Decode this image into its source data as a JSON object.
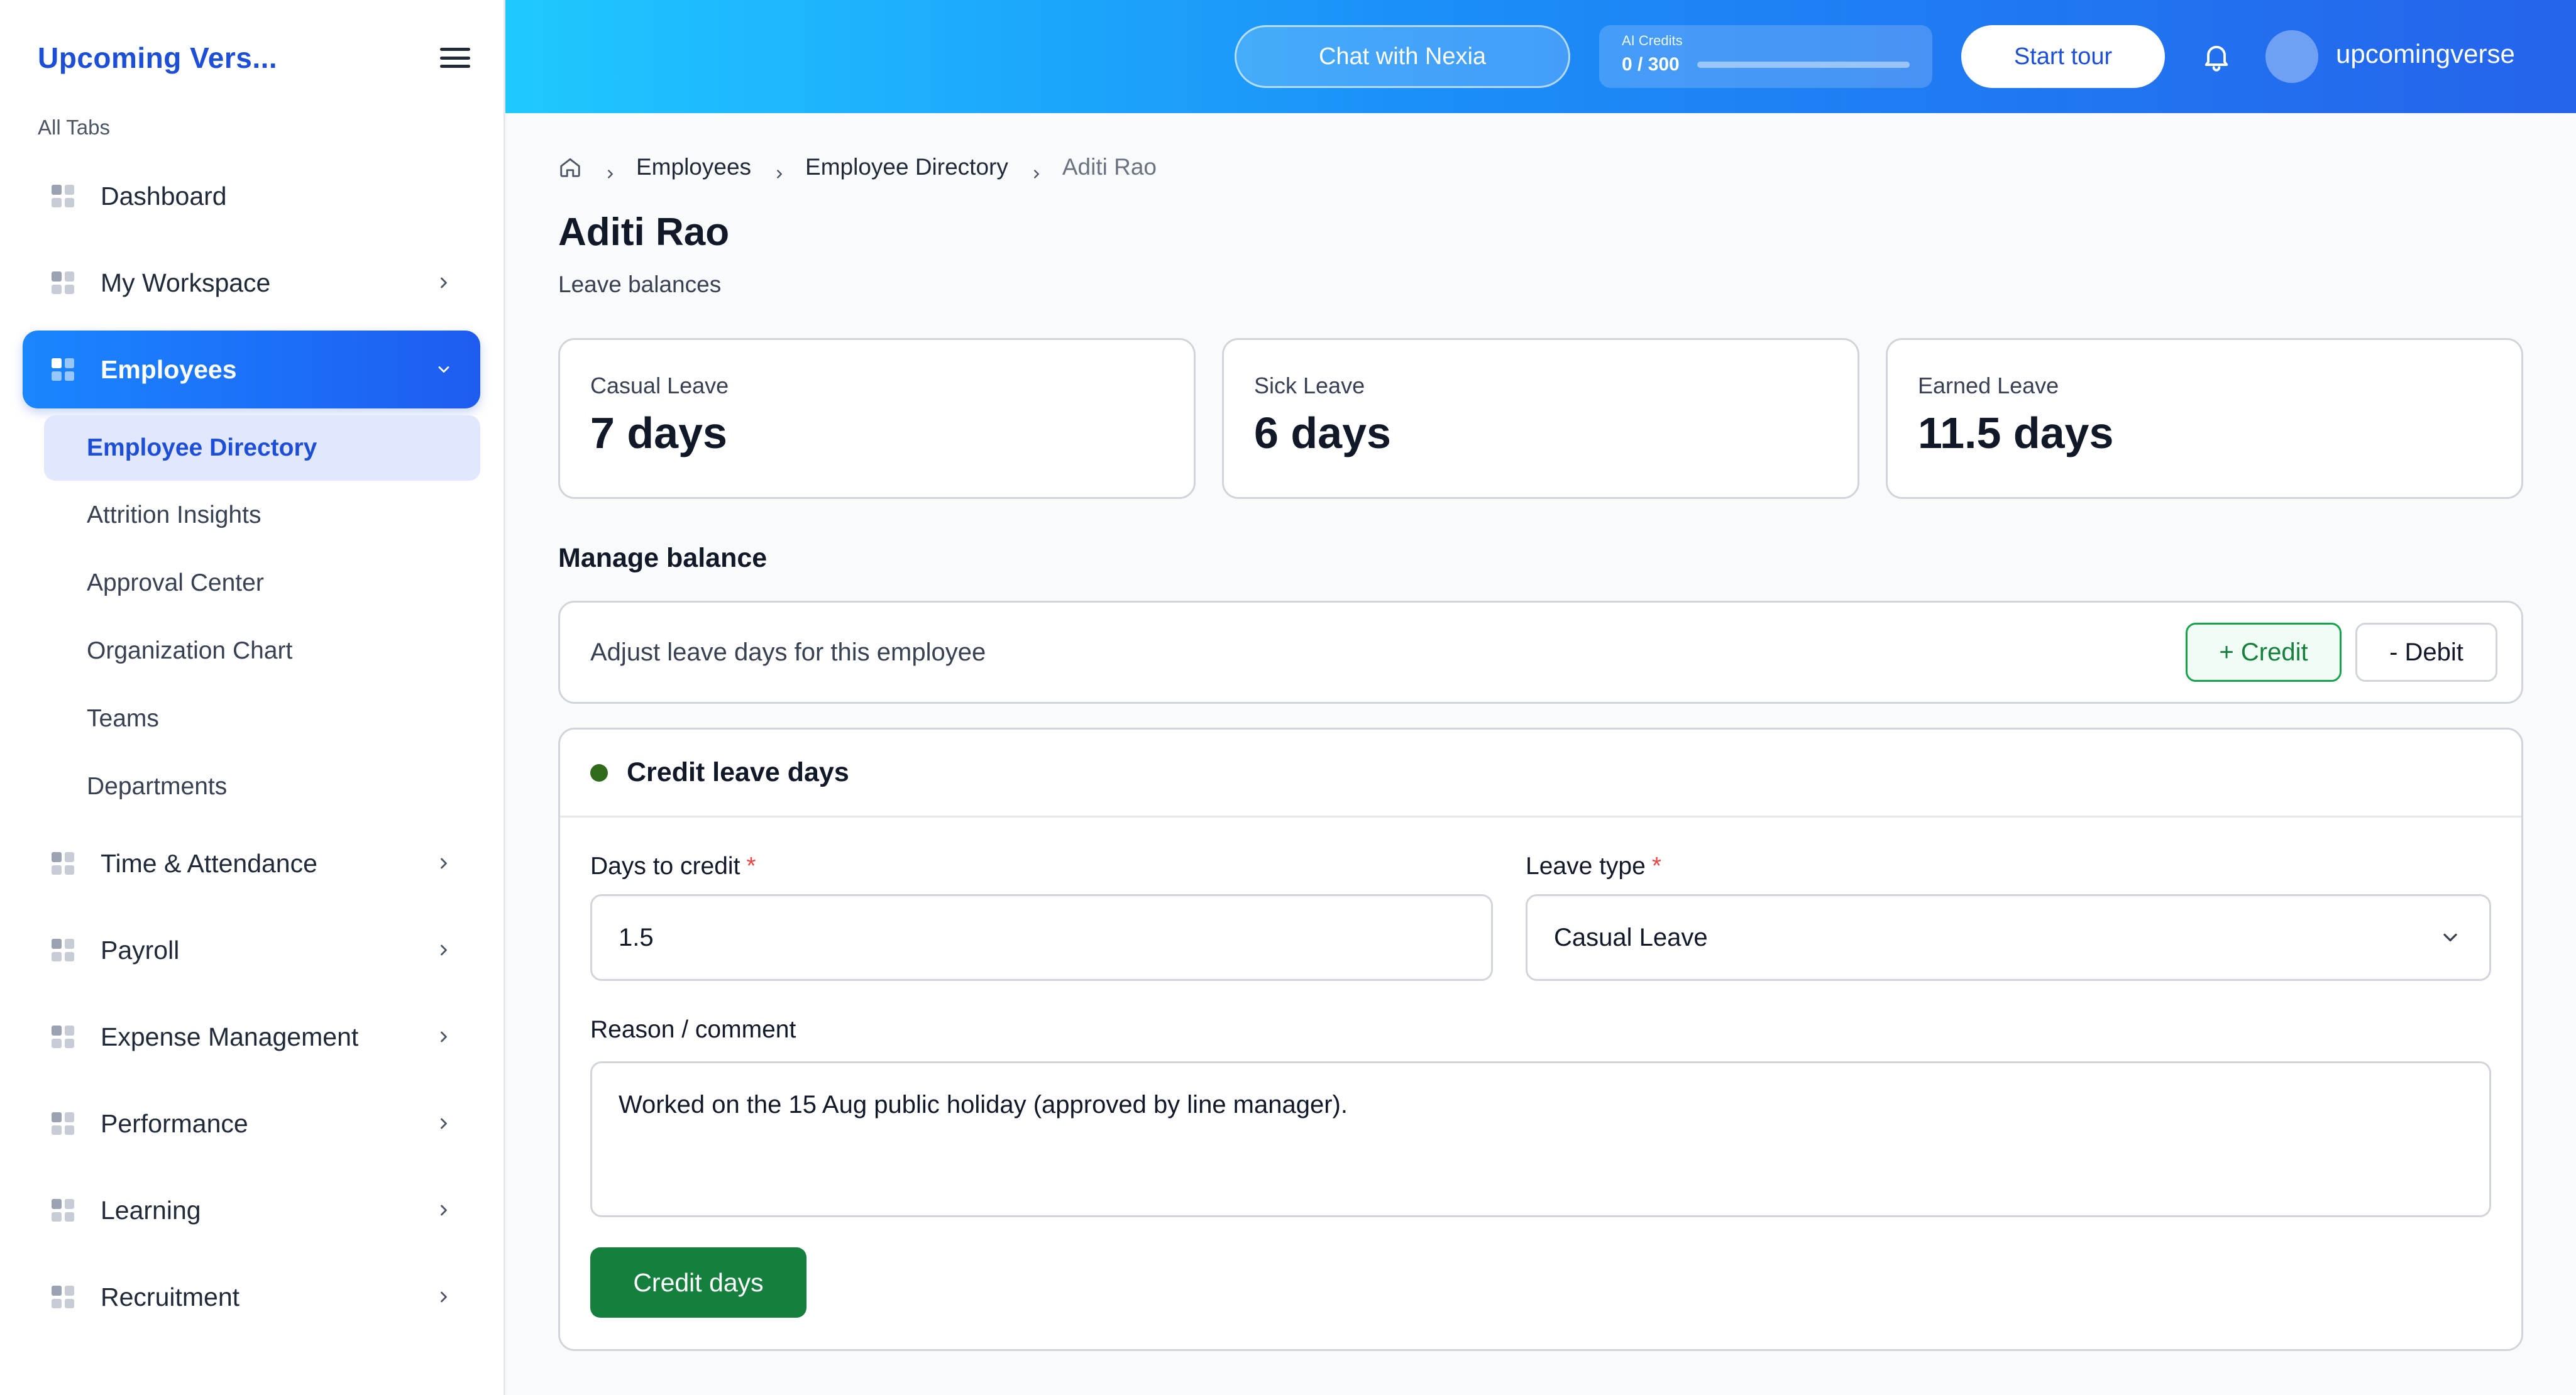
{
  "app": {
    "brand": "Upcoming Vers...",
    "all_tabs_label": "All Tabs"
  },
  "sidebar": {
    "items": [
      {
        "label": "Dashboard",
        "icon": "grid-icon",
        "has_chevron": false
      },
      {
        "label": "My Workspace",
        "icon": "grid-icon",
        "has_chevron": true
      },
      {
        "label": "Employees",
        "icon": "grid-icon",
        "has_chevron": true,
        "expanded": true,
        "active": true
      },
      {
        "label": "Time & Attendance",
        "icon": "grid-icon",
        "has_chevron": true
      },
      {
        "label": "Payroll",
        "icon": "grid-icon",
        "has_chevron": true
      },
      {
        "label": "Expense Management",
        "icon": "grid-icon",
        "has_chevron": true
      },
      {
        "label": "Performance",
        "icon": "grid-icon",
        "has_chevron": true
      },
      {
        "label": "Learning",
        "icon": "grid-icon",
        "has_chevron": true
      },
      {
        "label": "Recruitment",
        "icon": "grid-icon",
        "has_chevron": true
      }
    ],
    "employees_sub": [
      {
        "label": "Employee Directory",
        "active": true
      },
      {
        "label": "Attrition Insights"
      },
      {
        "label": "Approval Center"
      },
      {
        "label": "Organization Chart"
      },
      {
        "label": "Teams"
      },
      {
        "label": "Departments"
      }
    ]
  },
  "topbar": {
    "chat_label": "Chat with Nexia",
    "credits_label": "AI Credits",
    "credits_value": "0 / 300",
    "credits_used_fraction": 0.0,
    "tour_label": "Start tour",
    "username": "upcomingverse"
  },
  "breadcrumb": {
    "items": [
      "Employees",
      "Employee Directory"
    ],
    "current": "Aditi Rao"
  },
  "page": {
    "title": "Aditi Rao",
    "subtitle": "Leave balances"
  },
  "balances": [
    {
      "label": "Casual Leave",
      "value": "7 days"
    },
    {
      "label": "Sick Leave",
      "value": "6 days"
    },
    {
      "label": "Earned Leave",
      "value": "11.5 days"
    }
  ],
  "manage": {
    "title": "Manage balance",
    "adjust_text": "Adjust leave days for this employee",
    "credit_label": "+ Credit",
    "debit_label": "- Debit"
  },
  "form": {
    "title": "Credit leave days",
    "days_label": "Days to credit",
    "days_value": "1.5",
    "required_mark": "*",
    "leave_type_label": "Leave type",
    "leave_type_value": "Casual Leave",
    "reason_label": "Reason / comment",
    "reason_value": "Worked on the 15 Aug public holiday (approved by line manager).",
    "submit_label": "Credit days"
  },
  "colors": {
    "brand": "#1d4ed8",
    "accent_gradient_start": "#1fc8ff",
    "accent_gradient_end": "#2563eb",
    "credit_green": "#15803d",
    "status_dot": "#2f6b1a",
    "required": "#ef4444"
  }
}
